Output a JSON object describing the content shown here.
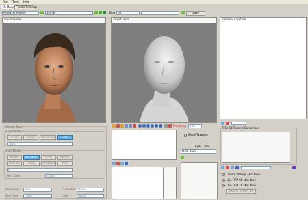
{
  "menu": [
    "File",
    "Tools",
    "Help"
  ],
  "tabs": [
    "3D Model",
    "Create Textures"
  ],
  "toolbar": {
    "name_value": "Arshavin Andrey",
    "id_value": "arshav",
    "filter_label": "Filter",
    "filter_value": "All",
    "save_label": "Save"
  },
  "panels": {
    "source": "Source Head",
    "target": "Target Head",
    "reference": "Reference Picture"
  },
  "generic_face": {
    "title": "Generic Face",
    "head_model_title": "Head Model",
    "ethnicities": [
      "African",
      "Asiatic",
      "Caucasian",
      "Latin"
    ],
    "head_model_value": "7020"
  },
  "hair_model": {
    "title": "Hair Model",
    "styles_row1": [
      "Shaven",
      "Very Short",
      "Short",
      "Modern"
    ],
    "styles_row2": [
      "Medium",
      "Long",
      "Headband",
      "Misc"
    ],
    "hair_select_value": "0",
    "hair_color_label": "Hair Color",
    "hair_color_value": "Brown"
  },
  "skin": {
    "skin_color_label": "Skin Color",
    "skin_color_value": "Pink",
    "facial_hair_label": "Facial Hair",
    "facial_hair_value": "None",
    "skin_type_label": "Skin Type",
    "skin_type_value": "Clean",
    "color_label": "Color",
    "color_value": "Black"
  },
  "morphing": {
    "label": "Morphing",
    "value": "100"
  },
  "target_options": {
    "show_textures_label": "Show Textures",
    "eyes_color_label": "Eyes Color",
    "eyes_color_value": "Dark Blue"
  },
  "conversion": {
    "title": "FIFA 08 Texture Conversion",
    "options": [
      "Do not change skin tone",
      "Use FIFA 08 skin tone",
      "Use FIFA 10 skin tone"
    ],
    "selected_index": 2,
    "button_label": "Export To FIFA 10"
  },
  "colors": {
    "accent_green": "#6abe3c",
    "selected_blue": "#62b0e6",
    "morphing_red": "#e02020"
  }
}
